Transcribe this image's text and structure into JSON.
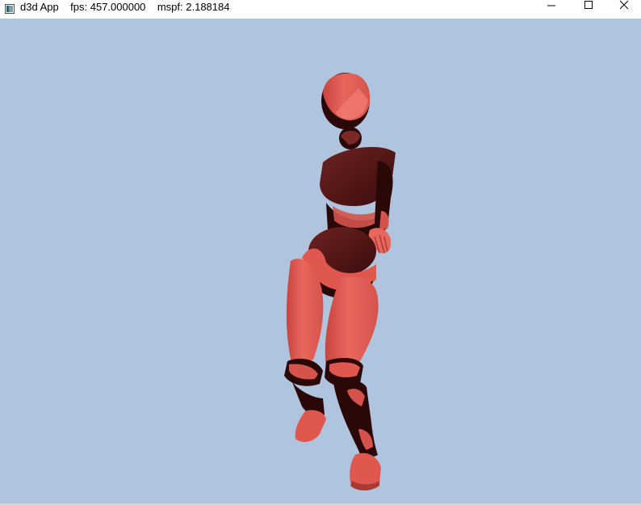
{
  "window": {
    "title": "d3d App    fps: 457.000000    mspf: 2.188184",
    "icon": "app-window-icon"
  },
  "caption_buttons": {
    "minimize": "minimize-icon",
    "maximize": "maximize-icon",
    "close": "close-icon"
  },
  "scene": {
    "background_color": "#b0c4de",
    "model_color": "#e0574f",
    "model_shadow_color": "#5a1818",
    "subject": "skinned-character-model"
  }
}
